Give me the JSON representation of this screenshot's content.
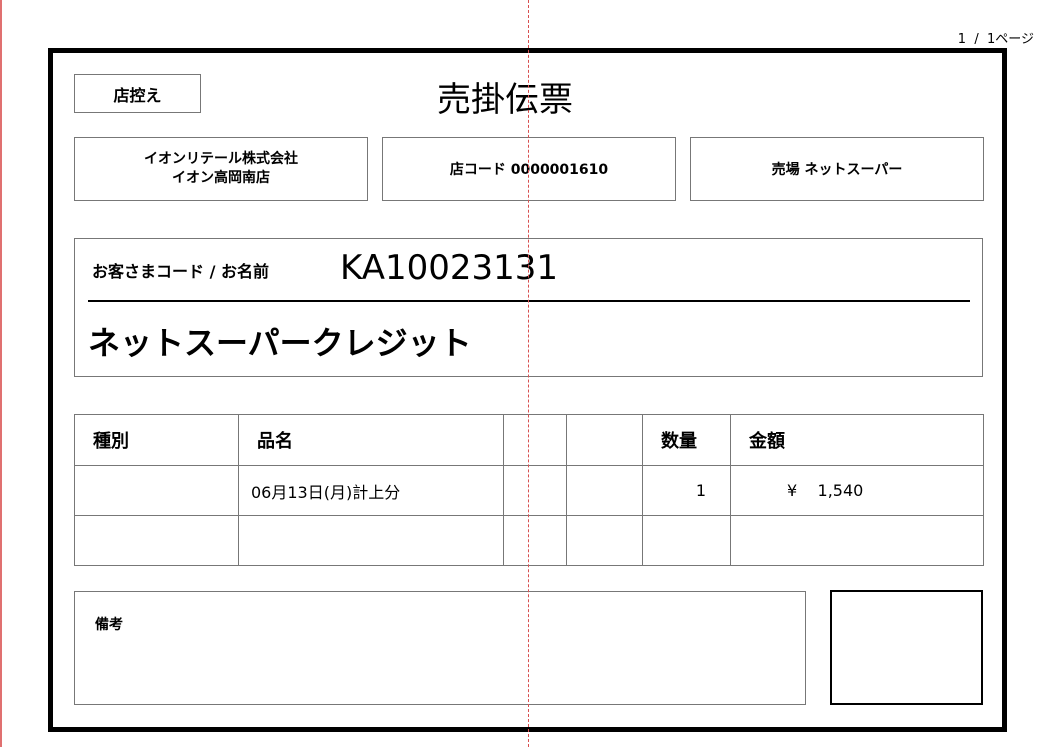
{
  "page_indicator": "1  /  1ページ",
  "store_copy_label": "店控え",
  "title": "売掛伝票",
  "company": {
    "line1": "イオンリテール株式会社",
    "line2": "イオン高岡南店"
  },
  "shop_code": "店コード 0000001610",
  "section": "売場 ネットスーパー",
  "customer": {
    "label": "お客さまコード / お名前",
    "code": "KA10023131",
    "name": "ネットスーパークレジット"
  },
  "table": {
    "headers": [
      "種別",
      "品名",
      "",
      "",
      "数量",
      "金額"
    ],
    "rows": [
      {
        "type": "",
        "product": "06月13日(月)計上分",
        "col3": "",
        "col4": "",
        "qty": "1",
        "amount": "¥    1,540"
      },
      {
        "type": "",
        "product": "",
        "col3": "",
        "col4": "",
        "qty": "",
        "amount": ""
      }
    ]
  },
  "remarks_label": "備考"
}
